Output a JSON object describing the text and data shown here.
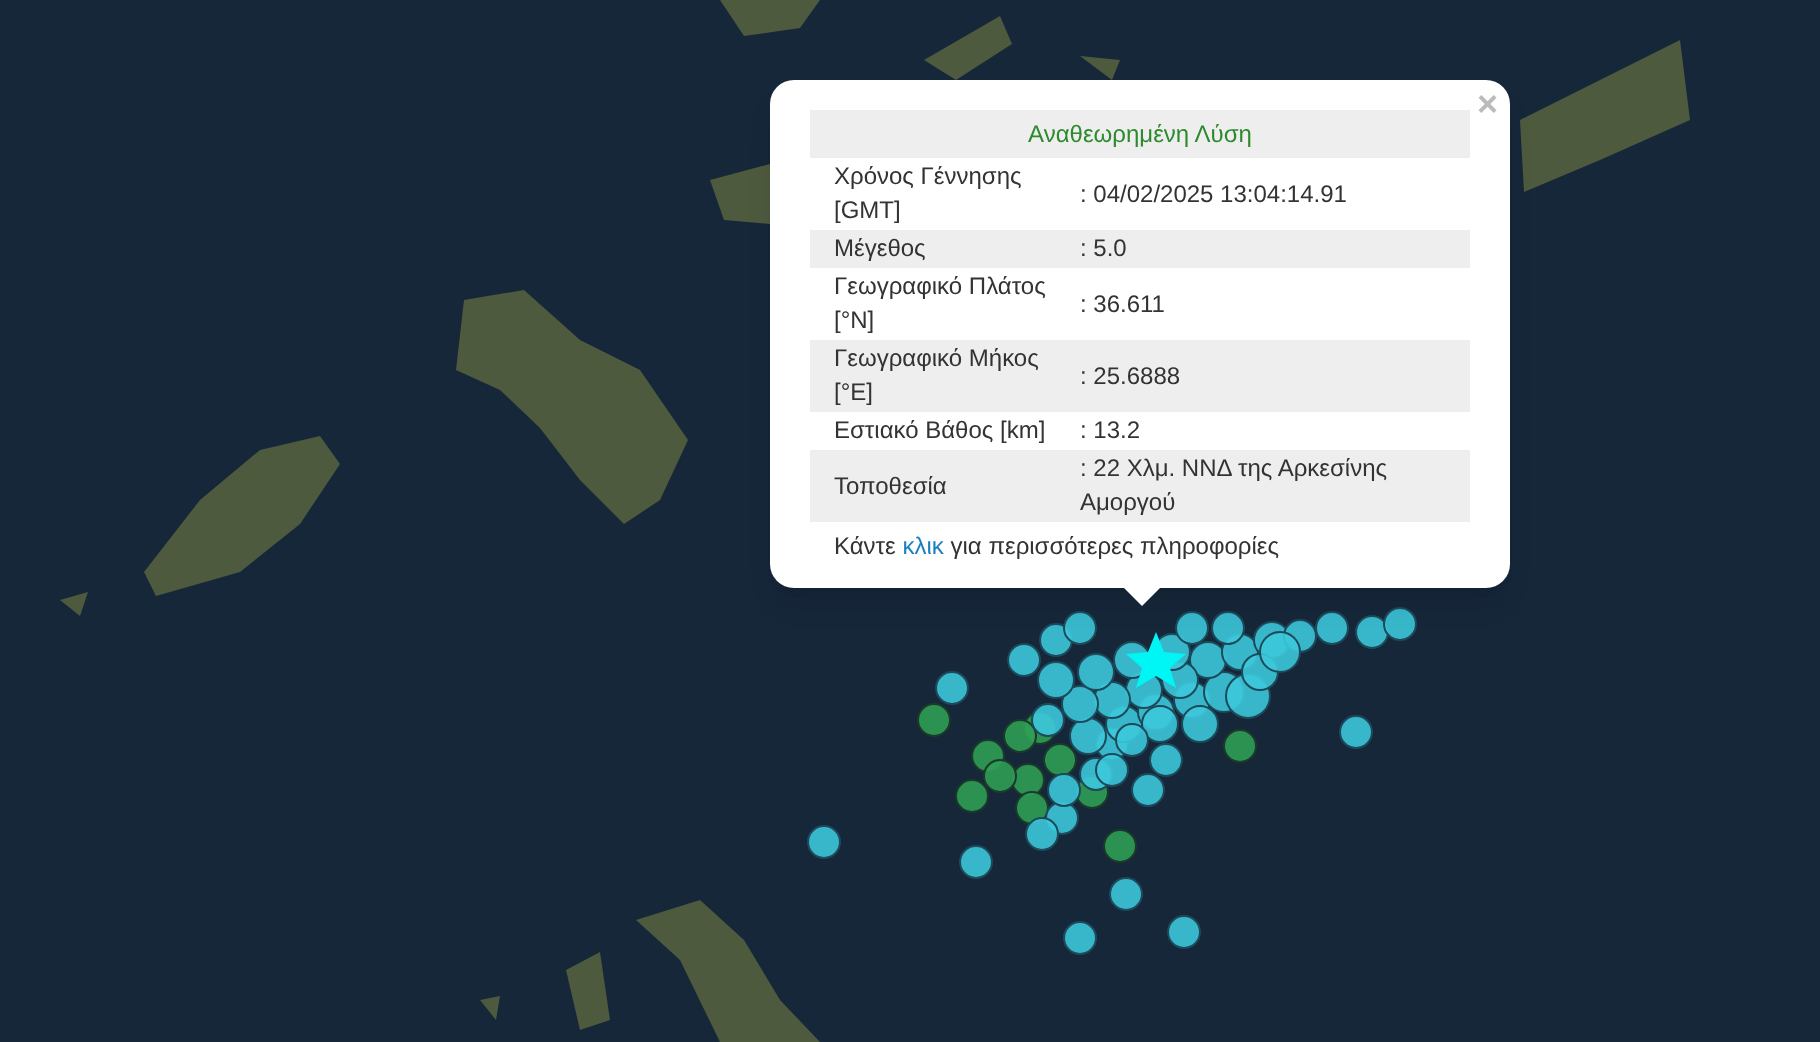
{
  "popup": {
    "close": "×",
    "title": "Αναθεωρημένη Λύση",
    "rows": [
      {
        "label": "Χρόνος Γέννησης [GMT]",
        "value": ": 04/02/2025 13:04:14.91"
      },
      {
        "label": "Μέγεθος",
        "value": ": 5.0"
      },
      {
        "label": "Γεωγραφικό Πλάτος [°N]",
        "value": ": 36.611"
      },
      {
        "label": "Γεωγραφικό Μήκος [°E]",
        "value": ": 25.6888"
      },
      {
        "label": "Εστιακό Βάθος [km]",
        "value": ": 13.2"
      },
      {
        "label": "Τοποθεσία",
        "value": ": 22 Χλμ. ΝΝΔ της Αρκεσίνης Αμοργού"
      }
    ],
    "footer": {
      "before": "Κάντε",
      "link": "κλικ",
      "after": "για περισσότερες πληροφορίες"
    }
  }
}
